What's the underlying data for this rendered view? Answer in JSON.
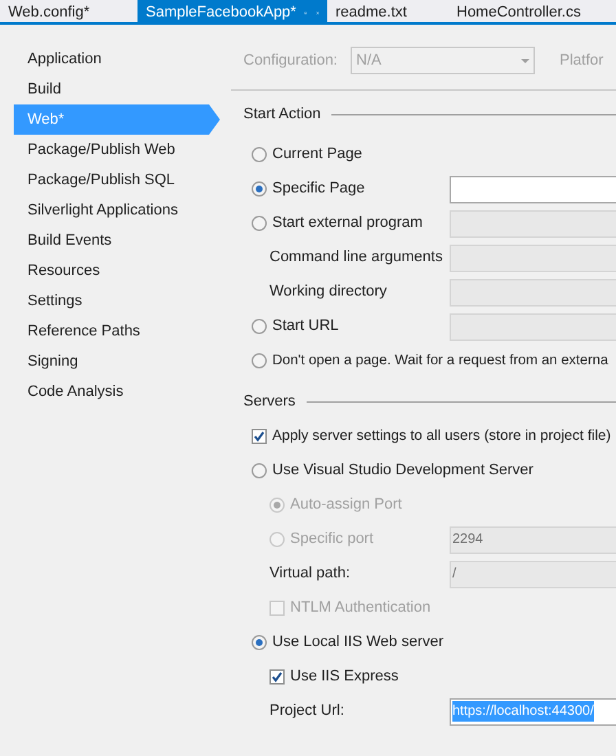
{
  "tabs": [
    {
      "label": "Web.config*",
      "selected": false
    },
    {
      "label": "SampleFacebookApp*",
      "selected": true
    },
    {
      "label": "readme.txt",
      "selected": false
    },
    {
      "label": "HomeController.cs",
      "selected": false
    }
  ],
  "sidebar": {
    "items": [
      {
        "label": "Application",
        "selected": false
      },
      {
        "label": "Build",
        "selected": false
      },
      {
        "label": "Web*",
        "selected": true
      },
      {
        "label": "Package/Publish Web",
        "selected": false
      },
      {
        "label": "Package/Publish SQL",
        "selected": false
      },
      {
        "label": "Silverlight Applications",
        "selected": false
      },
      {
        "label": "Build Events",
        "selected": false
      },
      {
        "label": "Resources",
        "selected": false
      },
      {
        "label": "Settings",
        "selected": false
      },
      {
        "label": "Reference Paths",
        "selected": false
      },
      {
        "label": "Signing",
        "selected": false
      },
      {
        "label": "Code Analysis",
        "selected": false
      }
    ]
  },
  "configuration": {
    "label": "Configuration:",
    "value": "N/A",
    "platform_label": "Platfor",
    "disabled": true
  },
  "sections": [
    {
      "title": "Start Action",
      "rows": [
        {
          "kind": "radio",
          "label": "Current Page",
          "selected": false,
          "disabled": false,
          "indented": false
        },
        {
          "kind": "radio",
          "label": "Specific Page",
          "selected": true,
          "disabled": false,
          "indented": false,
          "field": {
            "disabled": false
          }
        },
        {
          "kind": "radio",
          "label": "Start external program",
          "selected": false,
          "disabled": false,
          "indented": false,
          "field": {
            "disabled": true
          }
        },
        {
          "kind": "label",
          "label": "Command line arguments",
          "disabled": false,
          "indented": true,
          "field": {
            "disabled": true
          }
        },
        {
          "kind": "label",
          "label": "Working directory",
          "disabled": false,
          "indented": true,
          "field": {
            "disabled": true
          }
        },
        {
          "kind": "radio",
          "label": "Start URL",
          "selected": false,
          "disabled": false,
          "indented": false,
          "field": {
            "disabled": true
          }
        },
        {
          "kind": "radio",
          "label": "Don't open a page.  Wait for a request from an externa",
          "selected": false,
          "disabled": false,
          "indented": false
        }
      ]
    },
    {
      "title": "Servers",
      "rows": [
        {
          "kind": "checkbox",
          "label": "Apply server settings to all users (store in project file)",
          "checked": true,
          "disabled": false,
          "indented": false
        },
        {
          "kind": "radio",
          "label": "Use Visual Studio Development Server",
          "selected": false,
          "disabled": false,
          "indented": false
        },
        {
          "kind": "radio",
          "label": "Auto-assign Port",
          "selected": true,
          "disabled": true,
          "indented": true
        },
        {
          "kind": "radio",
          "label": "Specific port",
          "selected": false,
          "disabled": true,
          "indented": true,
          "field": {
            "value": "2294",
            "disabled": true
          }
        },
        {
          "kind": "label",
          "label": "Virtual path:",
          "disabled": false,
          "indented": true,
          "field": {
            "value": "/",
            "disabled": true
          }
        },
        {
          "kind": "checkbox",
          "label": "NTLM Authentication",
          "checked": false,
          "disabled": true,
          "indented": true
        },
        {
          "kind": "radio",
          "label": "Use Local IIS Web server",
          "selected": true,
          "disabled": false,
          "indented": false
        },
        {
          "kind": "checkbox",
          "label": "Use IIS Express",
          "checked": true,
          "disabled": false,
          "indented": true
        },
        {
          "kind": "label",
          "label": "Project Url:",
          "disabled": false,
          "indented": true,
          "field": {
            "value": "https://localhost:44300/",
            "disabled": false,
            "text_selected": true
          }
        }
      ]
    }
  ]
}
